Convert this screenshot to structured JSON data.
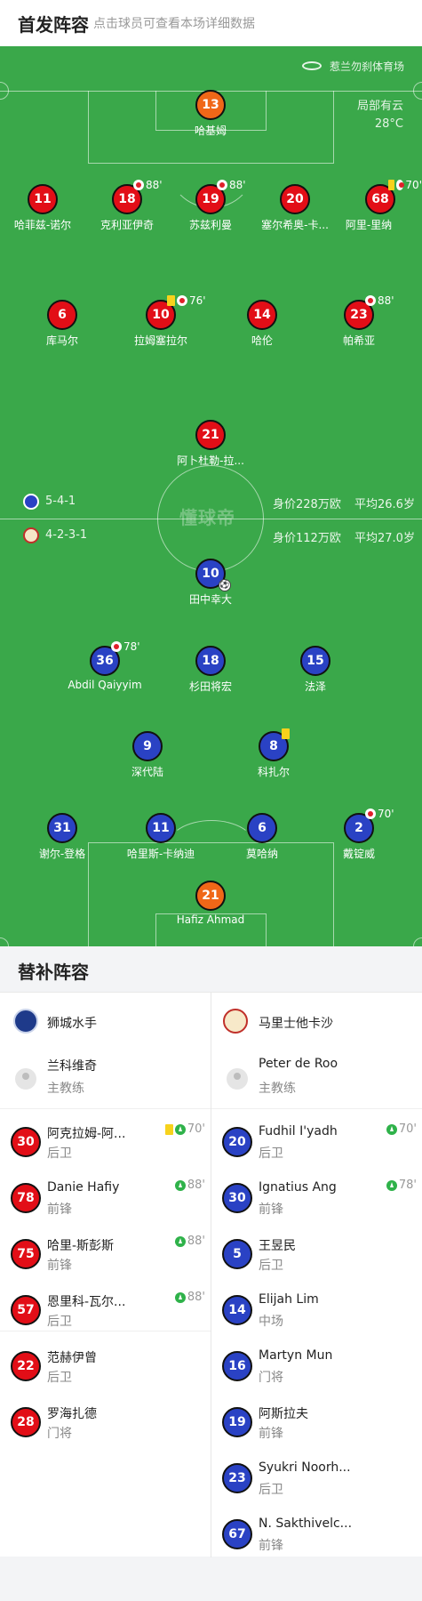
{
  "header": {
    "title": "首发阵容",
    "subtitle": "点击球员可查看本场详细数据"
  },
  "pitch": {
    "venue": "惹兰勿刹体育场",
    "weather": "局部有云",
    "temperature": "28°C",
    "watermark": "懂球帝"
  },
  "home": {
    "formation": "4-2-3-1",
    "market_value": "身价112万欧",
    "avg_age": "平均27.0岁",
    "players": {
      "gk": {
        "number": "21",
        "name": "Hafiz Ahmad"
      },
      "d1": {
        "number": "31",
        "name": "谢尔-登格"
      },
      "d2": {
        "number": "11",
        "name": "哈里斯-卡纳迪"
      },
      "d3": {
        "number": "6",
        "name": "莫哈纳"
      },
      "d4": {
        "number": "2",
        "name": "戴锭威",
        "sub_time": "70'"
      },
      "dm1": {
        "number": "9",
        "name": "深代陆"
      },
      "dm2": {
        "number": "8",
        "name": "科扎尔"
      },
      "am1": {
        "number": "36",
        "name": "Abdil Qaiyyim",
        "sub_time": "78'"
      },
      "am2": {
        "number": "18",
        "name": "杉田将宏"
      },
      "am3": {
        "number": "15",
        "name": "法泽"
      },
      "st": {
        "number": "10",
        "name": "田中幸大"
      }
    }
  },
  "away": {
    "formation": "5-4-1",
    "market_value": "身价228万欧",
    "avg_age": "平均26.6岁",
    "players": {
      "gk": {
        "number": "13",
        "name": "哈基姆"
      },
      "d1": {
        "number": "11",
        "name": "哈菲兹-诺尔"
      },
      "d2": {
        "number": "18",
        "name": "克利亚伊奇",
        "sub_time": "88'"
      },
      "d3": {
        "number": "19",
        "name": "苏兹利曼",
        "sub_time": "88'"
      },
      "d4": {
        "number": "20",
        "name": "塞尔希奥-卡..."
      },
      "d5": {
        "number": "68",
        "name": "阿里-里纳",
        "sub_time": "70'"
      },
      "m1": {
        "number": "6",
        "name": "库马尔"
      },
      "m2": {
        "number": "10",
        "name": "拉姆塞拉尔",
        "sub_time": "76'"
      },
      "m3": {
        "number": "14",
        "name": "哈伦"
      },
      "m4": {
        "number": "23",
        "name": "帕希亚",
        "sub_time": "88'"
      },
      "st": {
        "number": "21",
        "name": "阿卜杜勒-拉..."
      }
    }
  },
  "subs": {
    "title": "替补阵容",
    "left": {
      "team": "狮城水手",
      "coach_name": "兰科维奇",
      "coach_role": "主教练",
      "players": [
        {
          "number": "30",
          "name": "阿克拉姆-阿...",
          "pos": "后卫",
          "time": "70'"
        },
        {
          "number": "78",
          "name": "Danie Hafiy",
          "pos": "前锋",
          "time": "88'"
        },
        {
          "number": "75",
          "name": "哈里-斯彭斯",
          "pos": "前锋",
          "time": "88'"
        },
        {
          "number": "57",
          "name": "恩里科-瓦尔...",
          "pos": "后卫",
          "time": "88'"
        },
        {
          "number": "22",
          "name": "范赫伊曾",
          "pos": "后卫",
          "time": ""
        },
        {
          "number": "28",
          "name": "罗海扎德",
          "pos": "门将",
          "time": ""
        }
      ]
    },
    "right": {
      "team": "马里士他卡沙",
      "coach_name": "Peter de Roo",
      "coach_role": "主教练",
      "players": [
        {
          "number": "20",
          "name": "Fudhil I'yadh",
          "pos": "后卫",
          "time": "70'"
        },
        {
          "number": "30",
          "name": "Ignatius Ang",
          "pos": "前锋",
          "time": "78'"
        },
        {
          "number": "5",
          "name": "王昱民",
          "pos": "后卫",
          "time": ""
        },
        {
          "number": "14",
          "name": "Elijah Lim",
          "pos": "中场",
          "time": ""
        },
        {
          "number": "16",
          "name": "Martyn Mun",
          "pos": "门将",
          "time": ""
        },
        {
          "number": "19",
          "name": "阿斯拉夫",
          "pos": "前锋",
          "time": ""
        },
        {
          "number": "23",
          "name": "Syukri Noorh...",
          "pos": "后卫",
          "time": ""
        },
        {
          "number": "67",
          "name": "N. Sakthivelc...",
          "pos": "前锋",
          "time": ""
        }
      ]
    }
  },
  "colors": {
    "away": "#e20e17",
    "home": "#2a42c4",
    "goalkeeper": "#f06718",
    "pitch": "#3aa84a"
  }
}
